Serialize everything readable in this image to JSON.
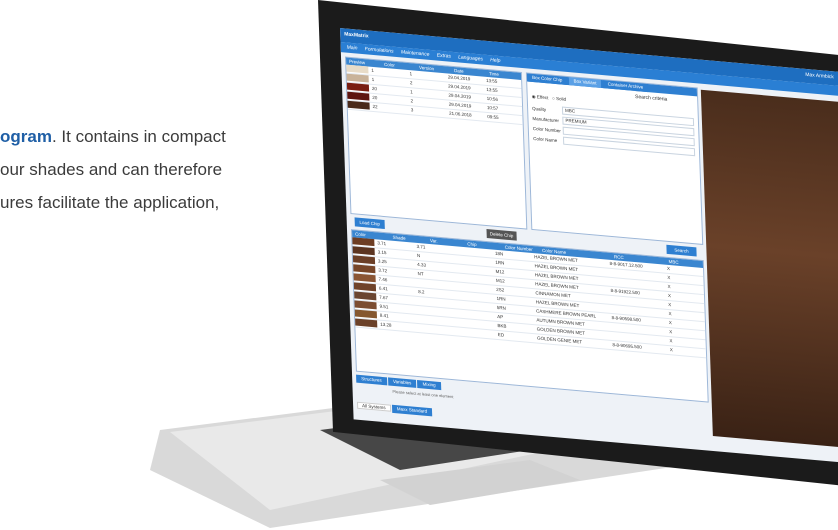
{
  "intro": {
    "line1_bold": "ogram",
    "line1_rest": ". It contains in compact",
    "line2": "our shades and can therefore",
    "line3": "ures facilitate the application,"
  },
  "app": {
    "title": "MaxMatrix",
    "user": "Max Armbick",
    "menu": [
      "Main",
      "Formulations",
      "Maintenance",
      "Extras",
      "Languages",
      "Help"
    ],
    "left_table": {
      "headers": [
        "Preview",
        "Color",
        "Version",
        "Date",
        "Time"
      ],
      "rows": [
        {
          "color": "1",
          "version": "1",
          "date": "29.04.2019",
          "time": "13:55",
          "swatch": "#e8dcc8"
        },
        {
          "color": "1",
          "version": "2",
          "date": "29.04.2019",
          "time": "13:55",
          "swatch": "#c9b39a"
        },
        {
          "color": "20",
          "version": "1",
          "date": "29.04.2019",
          "time": "10:56",
          "swatch": "#7a1e12"
        },
        {
          "color": "20",
          "version": "2",
          "date": "29.04.2019",
          "time": "10:57",
          "swatch": "#5e1510"
        },
        {
          "color": "22",
          "version": "3",
          "date": "21.06.2018",
          "time": "09:55",
          "swatch": "#4a2a1a"
        }
      ]
    },
    "search": {
      "tabs": [
        "Box Color Chip",
        "Box Variant",
        "Container Archive"
      ],
      "heading": "Search criteria",
      "radio": [
        "Effect",
        "Solid"
      ],
      "fields": [
        {
          "label": "Quality",
          "value": "MBC"
        },
        {
          "label": "Manufacturer",
          "value": "PREMIUM"
        },
        {
          "label": "Color Number",
          "value": ""
        },
        {
          "label": "Color Name",
          "value": ""
        }
      ],
      "search_button": "Search"
    },
    "buttons": {
      "load": "Load Chip",
      "delete": "Delete Chip"
    },
    "bottom_table": {
      "headers": [
        "Color",
        "Shade",
        "Var.",
        "Chip",
        "Color Number",
        "Color Name",
        "RCC",
        "MBC"
      ],
      "rows": [
        {
          "shade": "3.71",
          "var": "3.71",
          "chip": "",
          "num": "18N",
          "name": "HAZEL BROWN MET",
          "rcc": "8-8-9017.12.500",
          "mbc": "X",
          "swatch": "#6e3e24"
        },
        {
          "shade": "3.15",
          "var": "N",
          "chip": "",
          "num": "1RN",
          "name": "HAZEL BROWN MET",
          "rcc": "",
          "mbc": "X",
          "swatch": "#5c3521"
        },
        {
          "shade": "3.25",
          "var": "4.33",
          "chip": "",
          "num": "M12",
          "name": "HAZEL BROWN MET",
          "rcc": "",
          "mbc": "X",
          "swatch": "#6b3f27"
        },
        {
          "shade": "3.72",
          "var": "NT",
          "chip": "",
          "num": "M12",
          "name": "HAZEL BROWN MET",
          "rcc": "8-8-91922.500",
          "mbc": "X",
          "swatch": "#774629"
        },
        {
          "shade": "7.46",
          "var": "",
          "chip": "",
          "num": "2S2",
          "name": "CINNAMON MET",
          "rcc": "",
          "mbc": "X",
          "swatch": "#8a5534"
        },
        {
          "shade": "6.41",
          "var": "8.2",
          "chip": "",
          "num": "1RN",
          "name": "HAZEL BROWN MET",
          "rcc": "",
          "mbc": "X",
          "swatch": "#70432a"
        },
        {
          "shade": "7.67",
          "var": "",
          "chip": "",
          "num": "5RN",
          "name": "CASHMERE BROWN PEARL",
          "rcc": "8-8-90598.500",
          "mbc": "X",
          "swatch": "#6a4530"
        },
        {
          "shade": "9.51",
          "var": "",
          "chip": "",
          "num": "AP",
          "name": "AUTUMN BROWN MET",
          "rcc": "",
          "mbc": "X",
          "swatch": "#7c4d31"
        },
        {
          "shade": "8.41",
          "var": "",
          "chip": "",
          "num": "BKB",
          "name": "GOLDEN BROWN MET",
          "rcc": "",
          "mbc": "X",
          "swatch": "#85572f"
        },
        {
          "shade": "13.28",
          "var": "",
          "chip": "",
          "num": "ED",
          "name": "GOLDEN GENIE MET",
          "rcc": "8-8-90695.500",
          "mbc": "X",
          "swatch": "#6b4129"
        }
      ]
    },
    "bottom_tabs": [
      "Structures",
      "Variables",
      "Mixing"
    ],
    "status_hint": "Please select at least one element",
    "footer": [
      "All Systems",
      "Maxx Standard"
    ]
  }
}
